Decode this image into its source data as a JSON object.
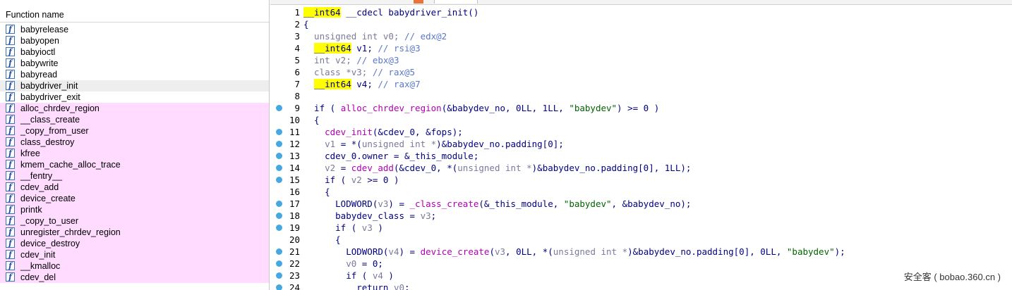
{
  "function_panel": {
    "header": "Function name",
    "icon_glyph": "f",
    "functions": [
      {
        "name": "babyrelease",
        "import": false,
        "selected": false
      },
      {
        "name": "babyopen",
        "import": false,
        "selected": false
      },
      {
        "name": "babyioctl",
        "import": false,
        "selected": false
      },
      {
        "name": "babywrite",
        "import": false,
        "selected": false
      },
      {
        "name": "babyread",
        "import": false,
        "selected": false
      },
      {
        "name": "babydriver_init",
        "import": false,
        "selected": true
      },
      {
        "name": "babydriver_exit",
        "import": false,
        "selected": false
      },
      {
        "name": "alloc_chrdev_region",
        "import": true,
        "selected": false
      },
      {
        "name": "__class_create",
        "import": true,
        "selected": false
      },
      {
        "name": "_copy_from_user",
        "import": true,
        "selected": false
      },
      {
        "name": "class_destroy",
        "import": true,
        "selected": false
      },
      {
        "name": "kfree",
        "import": true,
        "selected": false
      },
      {
        "name": "kmem_cache_alloc_trace",
        "import": true,
        "selected": false
      },
      {
        "name": "__fentry__",
        "import": true,
        "selected": false
      },
      {
        "name": "cdev_add",
        "import": true,
        "selected": false
      },
      {
        "name": "device_create",
        "import": true,
        "selected": false
      },
      {
        "name": "printk",
        "import": true,
        "selected": false
      },
      {
        "name": "_copy_to_user",
        "import": true,
        "selected": false
      },
      {
        "name": "unregister_chrdev_region",
        "import": true,
        "selected": false
      },
      {
        "name": "device_destroy",
        "import": true,
        "selected": false
      },
      {
        "name": "cdev_init",
        "import": true,
        "selected": false
      },
      {
        "name": "__kmalloc",
        "import": true,
        "selected": false
      },
      {
        "name": "cdev_del",
        "import": true,
        "selected": false
      }
    ]
  },
  "code_view": {
    "lines": [
      {
        "n": "1",
        "bp": false,
        "tokens": [
          [
            "hl",
            "__int64"
          ],
          [
            "plain",
            " __cdecl babydriver_init()"
          ]
        ]
      },
      {
        "n": "2",
        "bp": false,
        "tokens": [
          [
            "plain",
            "{"
          ]
        ]
      },
      {
        "n": "3",
        "bp": false,
        "tokens": [
          [
            "type",
            "  unsigned int v0; "
          ],
          [
            "comment",
            "// edx@2"
          ]
        ]
      },
      {
        "n": "4",
        "bp": false,
        "tokens": [
          [
            "plain",
            "  "
          ],
          [
            "hl",
            "__int64"
          ],
          [
            "plain",
            " v1; "
          ],
          [
            "comment",
            "// rsi@3"
          ]
        ]
      },
      {
        "n": "5",
        "bp": false,
        "tokens": [
          [
            "type",
            "  int v2; "
          ],
          [
            "comment",
            "// ebx@3"
          ]
        ]
      },
      {
        "n": "6",
        "bp": false,
        "tokens": [
          [
            "type",
            "  class *v3; "
          ],
          [
            "comment",
            "// rax@5"
          ]
        ]
      },
      {
        "n": "7",
        "bp": false,
        "tokens": [
          [
            "plain",
            "  "
          ],
          [
            "hl",
            "__int64"
          ],
          [
            "plain",
            " v4; "
          ],
          [
            "comment",
            "// rax@7"
          ]
        ]
      },
      {
        "n": "8",
        "bp": false,
        "tokens": [
          [
            "plain",
            ""
          ]
        ]
      },
      {
        "n": "9",
        "bp": true,
        "tokens": [
          [
            "plain",
            "  if ( "
          ],
          [
            "func",
            "alloc_chrdev_region"
          ],
          [
            "plain",
            "(&babydev_no, 0LL, 1LL, "
          ],
          [
            "str",
            "\"babydev\""
          ],
          [
            "plain",
            ") >= 0 )"
          ]
        ]
      },
      {
        "n": "10",
        "bp": false,
        "tokens": [
          [
            "plain",
            "  {"
          ]
        ]
      },
      {
        "n": "11",
        "bp": true,
        "tokens": [
          [
            "plain",
            "    "
          ],
          [
            "func",
            "cdev_init"
          ],
          [
            "plain",
            "(&cdev_0, &fops);"
          ]
        ]
      },
      {
        "n": "12",
        "bp": true,
        "tokens": [
          [
            "plain",
            "    "
          ],
          [
            "var",
            "v1"
          ],
          [
            "plain",
            " = *("
          ],
          [
            "type",
            "unsigned int *"
          ],
          [
            "plain",
            ")&babydev_no.padding[0];"
          ]
        ]
      },
      {
        "n": "13",
        "bp": true,
        "tokens": [
          [
            "plain",
            "    cdev_0.owner = &_this_module;"
          ]
        ]
      },
      {
        "n": "14",
        "bp": true,
        "tokens": [
          [
            "plain",
            "    "
          ],
          [
            "var",
            "v2"
          ],
          [
            "plain",
            " = "
          ],
          [
            "func",
            "cdev_add"
          ],
          [
            "plain",
            "(&cdev_0, *("
          ],
          [
            "type",
            "unsigned int *"
          ],
          [
            "plain",
            ")&babydev_no.padding[0], 1LL);"
          ]
        ]
      },
      {
        "n": "15",
        "bp": true,
        "tokens": [
          [
            "plain",
            "    if ( "
          ],
          [
            "var",
            "v2"
          ],
          [
            "plain",
            " >= 0 )"
          ]
        ]
      },
      {
        "n": "16",
        "bp": false,
        "tokens": [
          [
            "plain",
            "    {"
          ]
        ]
      },
      {
        "n": "17",
        "bp": true,
        "tokens": [
          [
            "plain",
            "      LODWORD("
          ],
          [
            "var",
            "v3"
          ],
          [
            "plain",
            ") = "
          ],
          [
            "func",
            "_class_create"
          ],
          [
            "plain",
            "(&_this_module, "
          ],
          [
            "str",
            "\"babydev\""
          ],
          [
            "plain",
            ", &babydev_no);"
          ]
        ]
      },
      {
        "n": "18",
        "bp": true,
        "tokens": [
          [
            "plain",
            "      babydev_class = "
          ],
          [
            "var",
            "v3"
          ],
          [
            "plain",
            ";"
          ]
        ]
      },
      {
        "n": "19",
        "bp": true,
        "tokens": [
          [
            "plain",
            "      if ( "
          ],
          [
            "var",
            "v3"
          ],
          [
            "plain",
            " )"
          ]
        ]
      },
      {
        "n": "20",
        "bp": false,
        "tokens": [
          [
            "plain",
            "      {"
          ]
        ]
      },
      {
        "n": "21",
        "bp": true,
        "tokens": [
          [
            "plain",
            "        LODWORD("
          ],
          [
            "var",
            "v4"
          ],
          [
            "plain",
            ") = "
          ],
          [
            "func",
            "device_create"
          ],
          [
            "plain",
            "("
          ],
          [
            "var",
            "v3"
          ],
          [
            "plain",
            ", 0LL, *("
          ],
          [
            "type",
            "unsigned int *"
          ],
          [
            "plain",
            ")&babydev_no.padding[0], 0LL, "
          ],
          [
            "str",
            "\"babydev\""
          ],
          [
            "plain",
            ");"
          ]
        ]
      },
      {
        "n": "22",
        "bp": true,
        "tokens": [
          [
            "plain",
            "        "
          ],
          [
            "var",
            "v0"
          ],
          [
            "plain",
            " = 0;"
          ]
        ]
      },
      {
        "n": "23",
        "bp": true,
        "tokens": [
          [
            "plain",
            "        if ( "
          ],
          [
            "var",
            "v4"
          ],
          [
            "plain",
            " )"
          ]
        ]
      },
      {
        "n": "24",
        "bp": true,
        "tokens": [
          [
            "plain",
            "          return "
          ],
          [
            "var",
            "v0"
          ],
          [
            "plain",
            ";"
          ]
        ]
      }
    ]
  },
  "watermark": "安全客 ( bobao.360.cn )",
  "colors": {
    "import_row": "#ffdcff",
    "highlight": "#ffff00",
    "breakpoint": "#47a8e0",
    "func_name": "#b000b0",
    "string": "#006400",
    "keyword": "#000080",
    "comment": "#5a78c8",
    "variable": "#7a7a9a"
  }
}
